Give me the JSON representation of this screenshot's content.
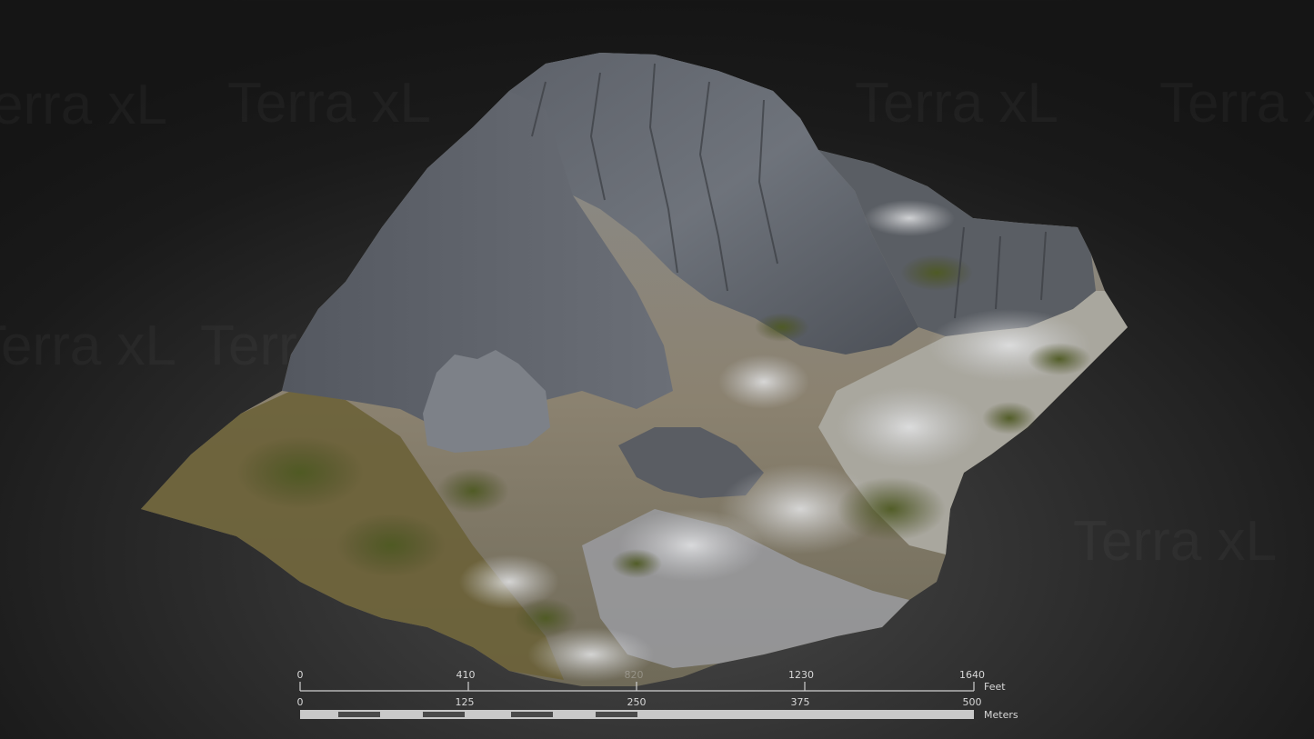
{
  "watermark": {
    "text": "Terra xL"
  },
  "scale": {
    "feet": {
      "unit": "Feet",
      "ticks": [
        "0",
        "410",
        "820",
        "1230",
        "1640"
      ]
    },
    "meters": {
      "unit": "Meters",
      "ticks": [
        "0",
        "125",
        "250",
        "375",
        "500"
      ]
    }
  },
  "colors": {
    "background": "#1e1e1e",
    "rock": "#6d7178",
    "grass": "#5b5a2c",
    "snow": "#d9dadc"
  }
}
